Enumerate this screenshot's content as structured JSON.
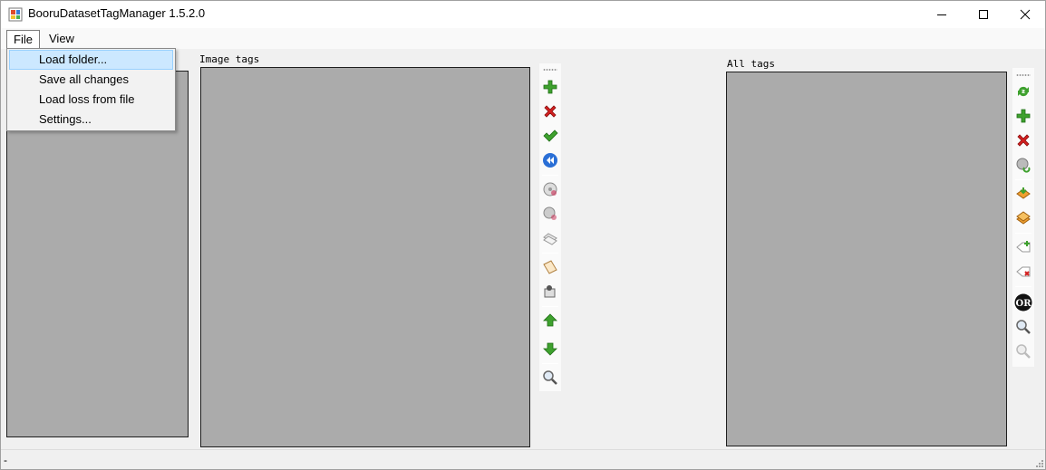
{
  "window": {
    "title": "BooruDatasetTagManager 1.5.2.0"
  },
  "menubar": {
    "items": [
      {
        "label": "File"
      },
      {
        "label": "View"
      }
    ]
  },
  "file_menu": {
    "items": [
      {
        "label": "Load folder..."
      },
      {
        "label": "Save all changes"
      },
      {
        "label": "Load loss from file"
      },
      {
        "label": "Settings..."
      }
    ]
  },
  "panels": {
    "image_tags_label": "Image tags",
    "all_tags_label": "All tags"
  },
  "status": {
    "text": "-"
  },
  "colors": {
    "list_bg": "#ababab",
    "menu_hover": "#cce8ff",
    "green": "#3ea12e",
    "red": "#d42020",
    "blue": "#2a6fd6"
  },
  "icons": {
    "image_toolbar": [
      "add-icon",
      "delete-icon",
      "apply-icon",
      "rewind-icon",
      "disk-add-icon",
      "disk-remove-icon",
      "replace-icon",
      "paste-icon",
      "clear-icon",
      "move-up-icon",
      "move-down-icon",
      "search-icon"
    ],
    "all_tags_toolbar": [
      "refresh-icon",
      "add-icon",
      "delete-icon",
      "replace-icon",
      "add-to-all-icon",
      "add-selected-icon",
      "tag-add-icon",
      "tag-remove-icon",
      "or-icon",
      "search-icon",
      "search-disabled-icon"
    ]
  }
}
